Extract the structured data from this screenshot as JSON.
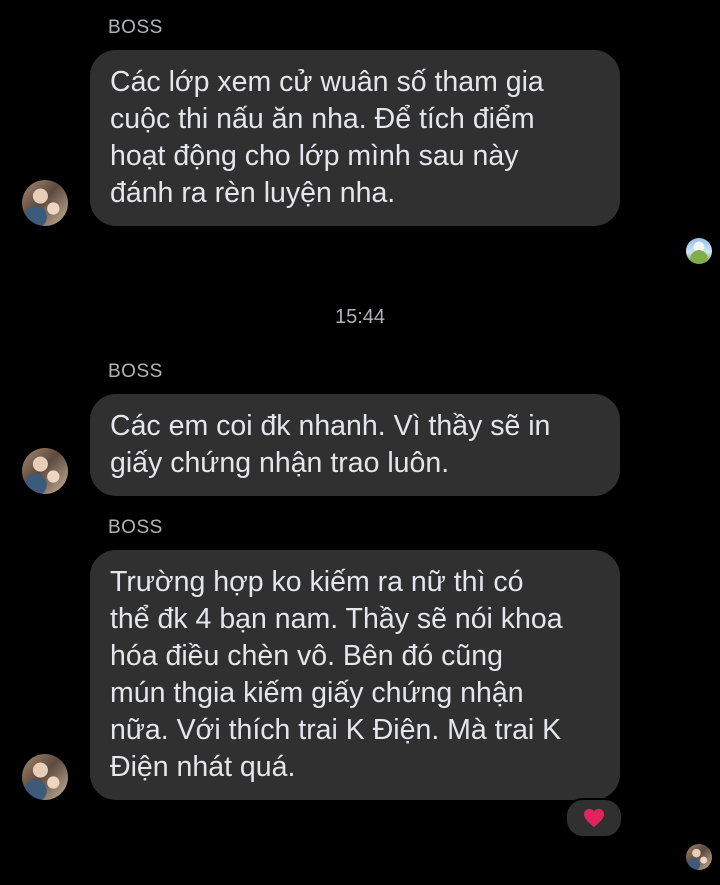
{
  "messages": [
    {
      "sender": "BOSS",
      "text": "Các lớp xem cử wuân số tham gia\ncuộc thi nấu ăn nha. Để tích điểm\nhoạt động cho lớp mình sau này\nđánh ra rèn luyện nha."
    },
    {
      "sender": "BOSS",
      "text": "Các em coi đk nhanh. Vì thầy sẽ in\ngiấy chứng nhận trao luôn."
    },
    {
      "sender": "BOSS",
      "text": "Trường hợp ko kiếm ra nữ thì có\nthể đk 4 bạn nam. Thầy sẽ nói khoa\nhóa điều chèn vô. Bên đó cũng\nmún thgia kiếm giấy chứng nhận\nnữa. Với thích trai K Điện. Mà trai K\nĐiện nhát quá."
    }
  ],
  "timestamp": "15:44",
  "reaction": {
    "icon": "heart-icon",
    "color": "#e0245e"
  }
}
